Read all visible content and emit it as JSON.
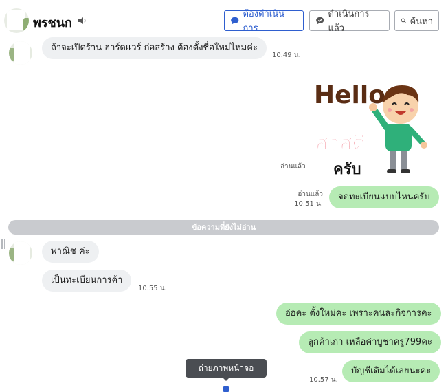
{
  "header": {
    "contact_name": "พรชนก",
    "buttons": {
      "todo": "ต้องดำเนินการ",
      "done": "ดำเนินการแล้ว",
      "search": "ค้นหา"
    },
    "colors": {
      "accent": "#2f5fcf"
    }
  },
  "messages": {
    "m1": {
      "text": "ถ้าจะเปิดร้าน ฮาร์ดแวร์ ก่อสร้าง ต้องตั้งชื่อใหม่ไหมค่ะ",
      "time": "10.49 น."
    },
    "sticker": {
      "line1": "Hello",
      "line2": "สวัสดี",
      "line3": "ครับ",
      "read": "อ่านแล้ว"
    },
    "m2": {
      "text": "จดทะเบียนแบบไหนครับ",
      "read": "อ่านแล้ว",
      "time": "10.51 น."
    },
    "unread_divider": "ข้อความที่ยังไม่อ่าน",
    "m3": {
      "text": "พาณิช ค่ะ"
    },
    "m4": {
      "text": "เป็นทะเบียนการค้า",
      "time": "10.55 น."
    },
    "m5": {
      "text": "อ่อคะ ตั้งใหม่คะ เพราะคนละกิจการคะ"
    },
    "m6": {
      "text": "ลูกค้าเก่า เหลือค่าบูชาครู799คะ"
    },
    "m7": {
      "text": "บัญชีเดิมได้เลยนะคะ",
      "time": "10.57 น."
    }
  },
  "tooltip": "ถ่ายภาพหน้าจอ",
  "colors": {
    "outgoing_bubble": "#b6ebb4",
    "incoming_bubble": "#eef0f2",
    "divider": "#c9cbcf"
  }
}
